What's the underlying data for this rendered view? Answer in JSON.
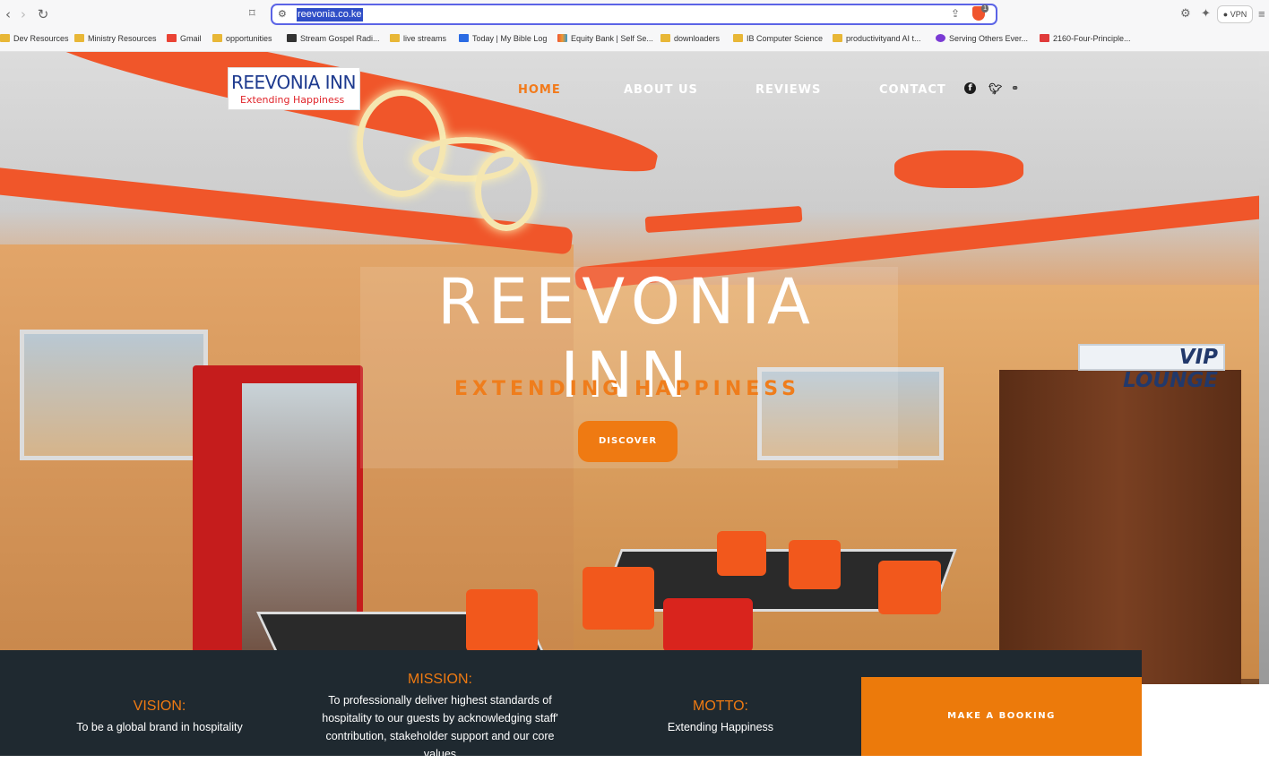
{
  "browser": {
    "url": "reevonia.co.ke",
    "vpn_label": "VPN",
    "shield_count": "1",
    "bookmarks": [
      {
        "label": "Dev Resources",
        "icon": "folder-icon"
      },
      {
        "label": "Ministry Resources",
        "icon": "folder-icon"
      },
      {
        "label": "Gmail",
        "icon": "gmail-icon"
      },
      {
        "label": "opportunities",
        "icon": "folder-icon"
      },
      {
        "label": "Stream Gospel Radi...",
        "icon": "radio-icon"
      },
      {
        "label": "live streams",
        "icon": "folder-icon"
      },
      {
        "label": "Today | My Bible Log",
        "icon": "bible-log-icon"
      },
      {
        "label": "Equity Bank | Self Se...",
        "icon": "equity-icon"
      },
      {
        "label": "downloaders",
        "icon": "folder-icon"
      },
      {
        "label": "IB Computer Science",
        "icon": "folder-icon"
      },
      {
        "label": "productivityand AI t...",
        "icon": "folder-icon"
      },
      {
        "label": "Serving Others Ever...",
        "icon": "serving-icon"
      },
      {
        "label": "2160-Four-Principle...",
        "icon": "heart-icon"
      }
    ]
  },
  "site": {
    "logo_name": "REEVONIA INN",
    "logo_tagline": "Extending Happiness",
    "nav": [
      {
        "label": "HOME",
        "active": true
      },
      {
        "label": "ABOUT US",
        "active": false
      },
      {
        "label": "REVIEWS",
        "active": false
      },
      {
        "label": "CONTACT",
        "active": false
      }
    ],
    "social": [
      "facebook-icon",
      "twitter-icon",
      "tripadvisor-icon"
    ],
    "hero_title": "REEVONIA INN",
    "hero_tagline": "EXTENDING HAPPINESS",
    "discover_label": "DISCOVER",
    "vip_sign": "VIP LOUNGE"
  },
  "info": {
    "vision_heading": "VISION:",
    "vision_text": "To be a global brand in hospitality",
    "mission_heading": "MISSION:",
    "mission_text": "To professionally deliver highest standards of hospitality to our guests by acknowledging staff' contribution, stakeholder support and our core values",
    "motto_heading": "MOTTO:",
    "motto_text": "Extending Happiness",
    "booking_label": "MAKE A BOOKING"
  },
  "colors": {
    "accent": "#ef7a12",
    "dark_bar": "#1f2930",
    "logo_blue": "#1f3b8f",
    "logo_red": "#e0242a"
  }
}
